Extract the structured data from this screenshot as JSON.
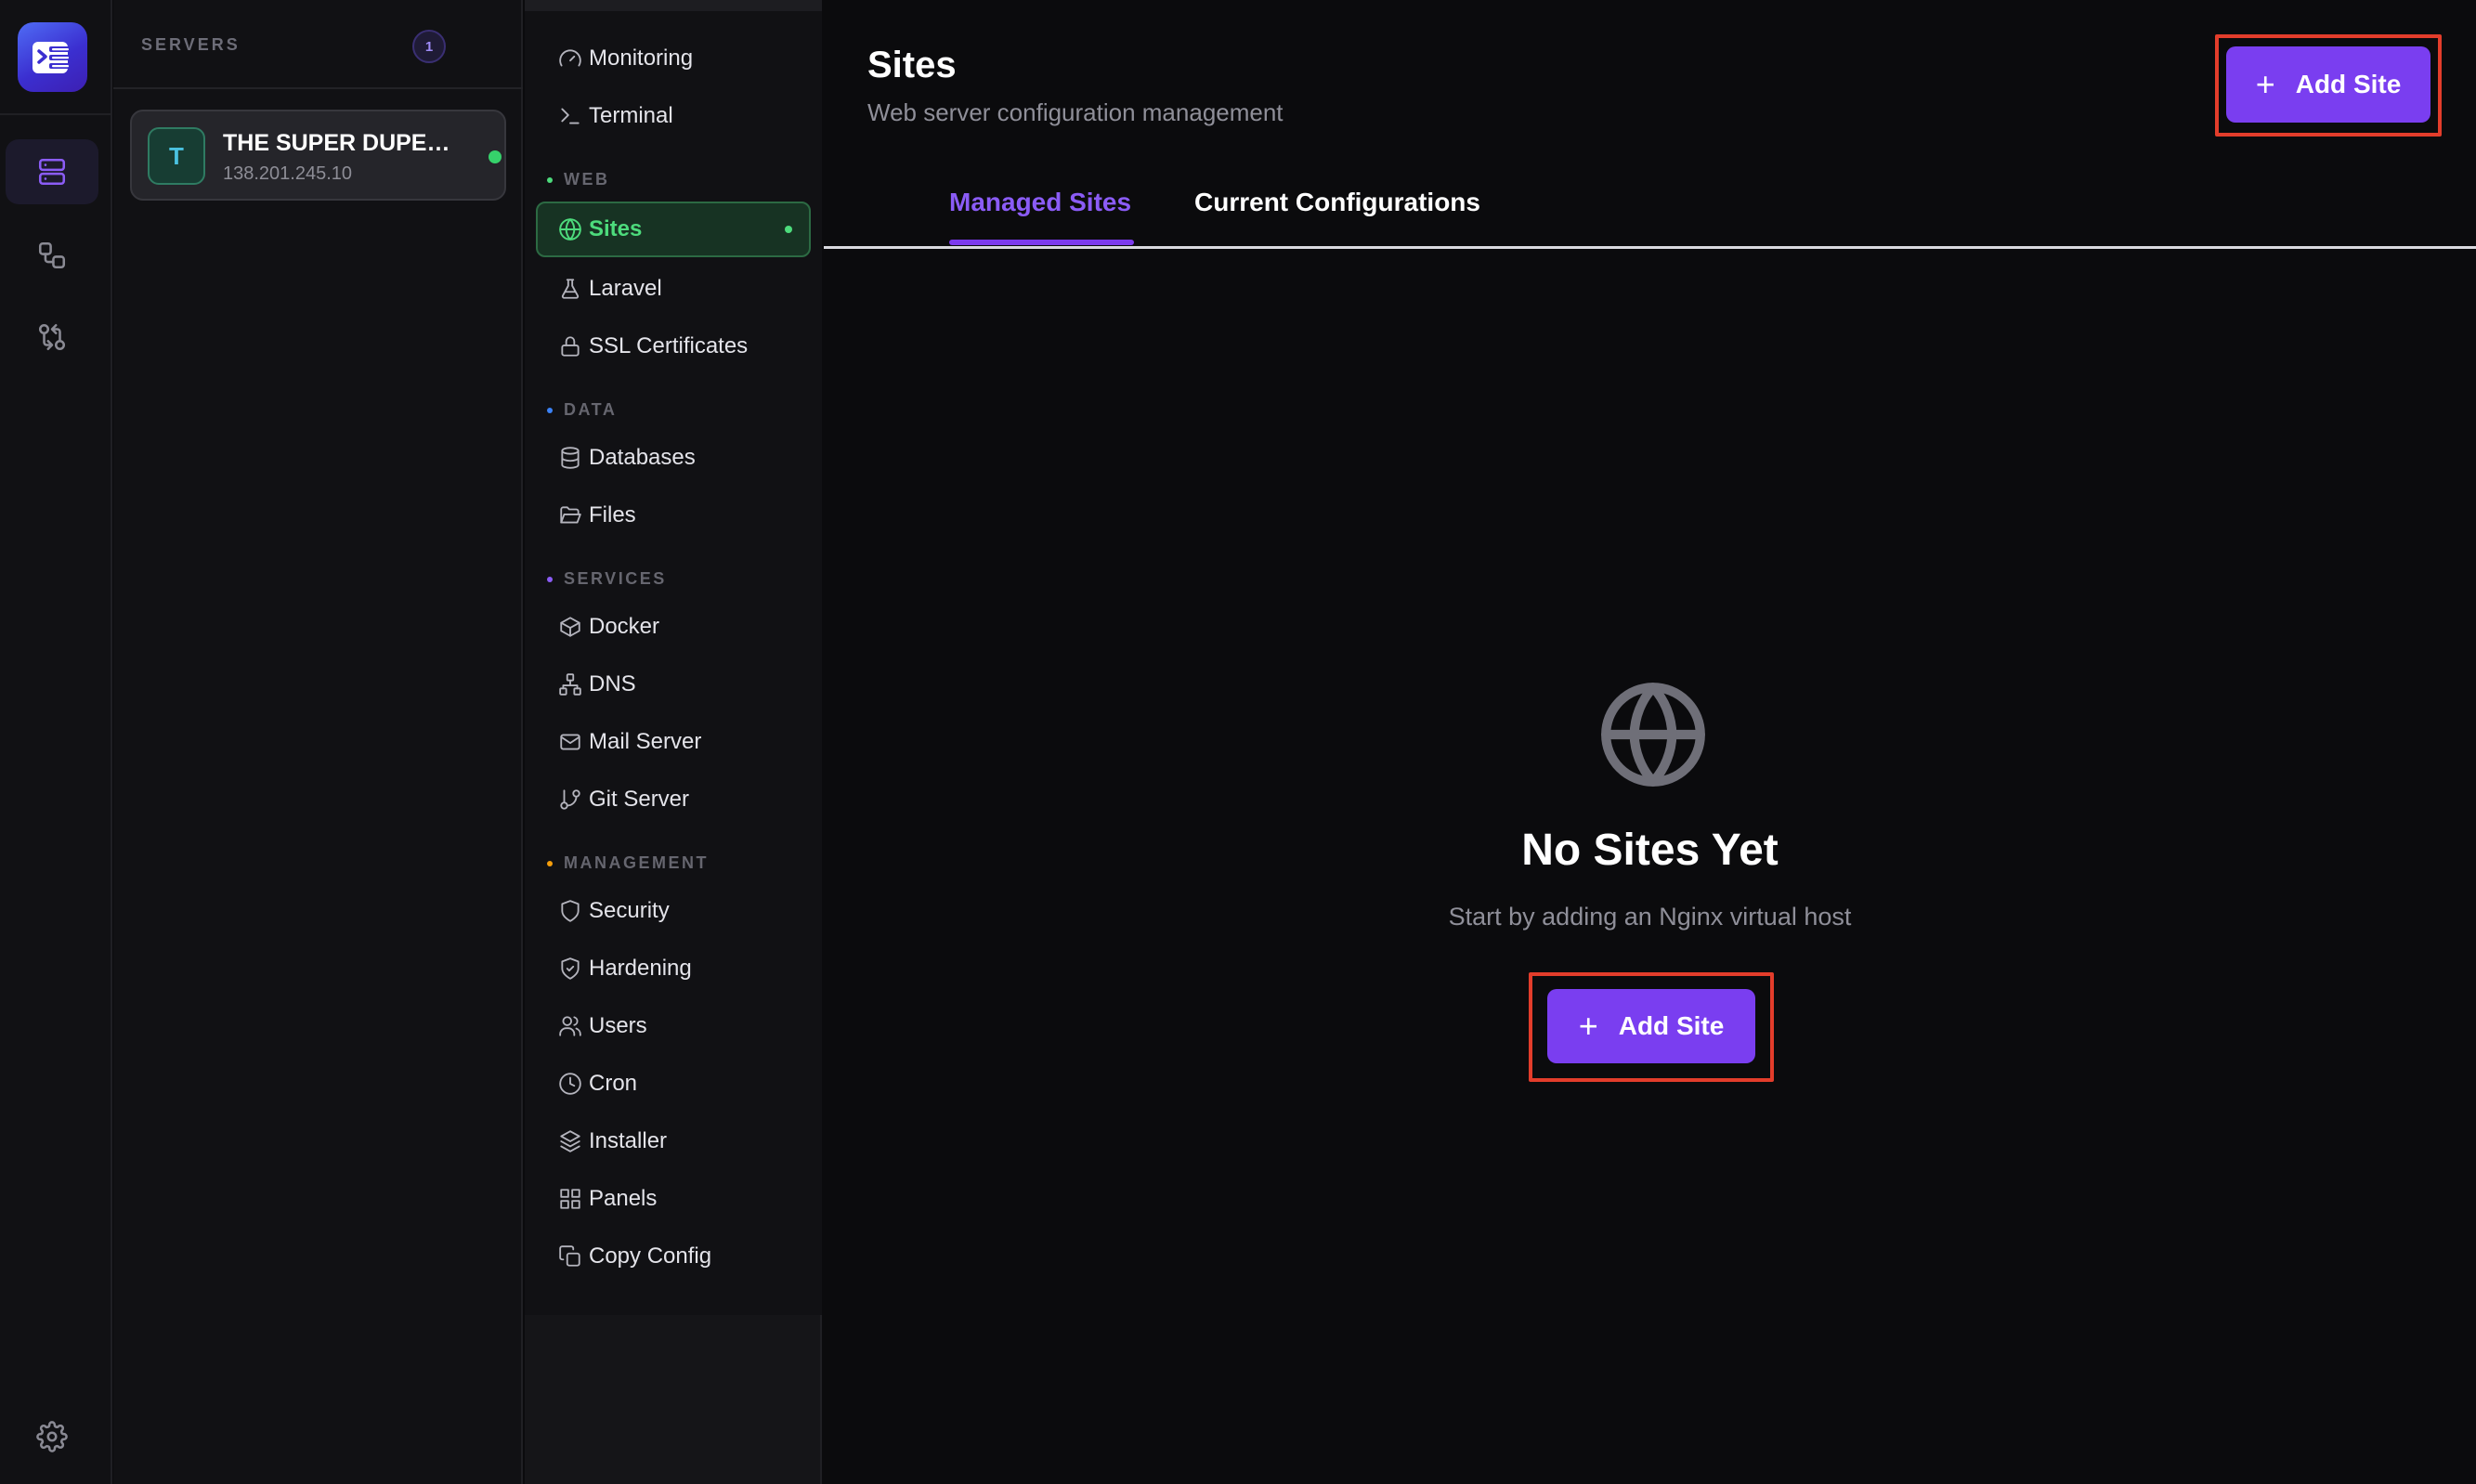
{
  "servers": {
    "title": "SERVERS",
    "count": "1",
    "items": [
      {
        "initial": "T",
        "name": "THE SUPER DUPER...",
        "ip": "138.201.245.10",
        "status": "online"
      }
    ]
  },
  "nav": {
    "items_top": [
      {
        "label": "Monitoring",
        "icon": "gauge-icon"
      },
      {
        "label": "Terminal",
        "icon": "terminal-icon"
      }
    ],
    "sections": [
      {
        "title": "WEB",
        "color": "#4ddb7c",
        "items": [
          {
            "label": "Sites",
            "icon": "globe-icon",
            "active": true
          },
          {
            "label": "Laravel",
            "icon": "flask-icon"
          },
          {
            "label": "SSL Certificates",
            "icon": "lock-icon"
          }
        ]
      },
      {
        "title": "DATA",
        "color": "#3b82f6",
        "items": [
          {
            "label": "Databases",
            "icon": "database-icon"
          },
          {
            "label": "Files",
            "icon": "folder-open-icon"
          }
        ]
      },
      {
        "title": "SERVICES",
        "color": "#8b5cf6",
        "items": [
          {
            "label": "Docker",
            "icon": "box-icon"
          },
          {
            "label": "DNS",
            "icon": "network-icon"
          },
          {
            "label": "Mail Server",
            "icon": "mail-icon"
          },
          {
            "label": "Git Server",
            "icon": "git-branch-icon"
          }
        ]
      },
      {
        "title": "MANAGEMENT",
        "color": "#f59e0b",
        "items": [
          {
            "label": "Security",
            "icon": "shield-icon"
          },
          {
            "label": "Hardening",
            "icon": "shield-check-icon"
          },
          {
            "label": "Users",
            "icon": "users-icon"
          },
          {
            "label": "Cron",
            "icon": "clock-icon"
          },
          {
            "label": "Installer",
            "icon": "package-icon"
          },
          {
            "label": "Panels",
            "icon": "grid-icon"
          },
          {
            "label": "Copy Config",
            "icon": "copy-icon"
          }
        ]
      }
    ]
  },
  "main": {
    "title": "Sites",
    "subtitle": "Web server configuration management",
    "header_button": "Add Site",
    "tabs": [
      {
        "label": "Managed Sites",
        "active": true
      },
      {
        "label": "Current Configurations",
        "active": false
      }
    ],
    "empty": {
      "icon": "globe-icon",
      "title": "No Sites Yet",
      "description": "Start by adding an Nginx virtual host",
      "button": "Add Site"
    }
  },
  "colors": {
    "accent": "#7a3ef0",
    "active_green": "#4ddb7c",
    "highlight": "#e33d2b"
  }
}
